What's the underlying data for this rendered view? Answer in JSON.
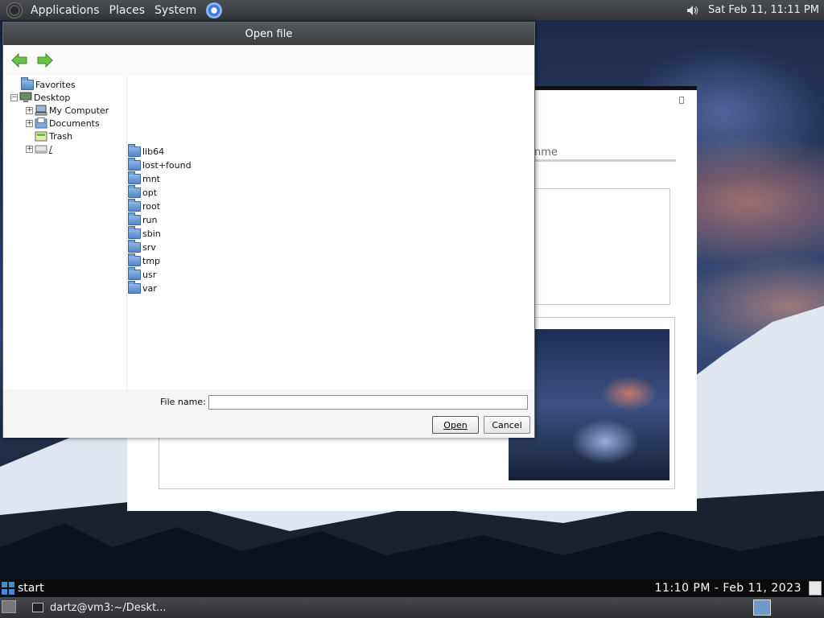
{
  "top_panel": {
    "menus": [
      "Applications",
      "Places",
      "System"
    ],
    "clock": "Sat Feb 11, 11:11 PM"
  },
  "background_window": {
    "tab_text": "nme"
  },
  "dialog": {
    "title": "Open file",
    "tree": [
      {
        "label": "Favorites",
        "icon": "favorites-folder-icon",
        "level": 0,
        "expander": ""
      },
      {
        "label": "Desktop",
        "icon": "desktop-icon",
        "level": 0,
        "expander": "−"
      },
      {
        "label": "My Computer",
        "icon": "computer-icon",
        "level": 1,
        "expander": "+"
      },
      {
        "label": "Documents",
        "icon": "documents-icon",
        "level": 1,
        "expander": "+"
      },
      {
        "label": "Trash",
        "icon": "trash-icon",
        "level": 1,
        "expander": ""
      },
      {
        "label": "/",
        "icon": "drive-icon",
        "level": 1,
        "expander": "+"
      }
    ],
    "files": [
      "lib64",
      "lost+found",
      "mnt",
      "opt",
      "root",
      "run",
      "sbin",
      "srv",
      "tmp",
      "usr",
      "var"
    ],
    "file_name_label": "File name:",
    "file_name_value": "",
    "open_label": "Open",
    "cancel_label": "Cancel"
  },
  "taskbar": {
    "start_label": "start",
    "clock": "11:10 PM - Feb 11, 2023",
    "terminal_task": "dartz@vm3:~/Deskt..."
  },
  "colors": {
    "panel": "#3b3d41",
    "accent": "#3e8ad8",
    "folder": "#4f86c6"
  }
}
